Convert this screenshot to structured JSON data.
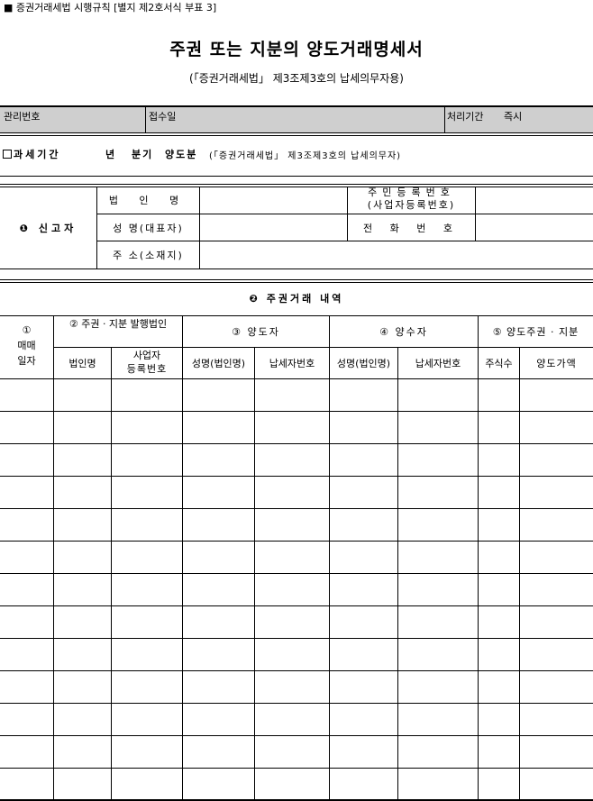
{
  "header": {
    "law_reference": "■ 증권거래세법 시행규칙 [별지 제2호서식 부표 3]",
    "title": "주권 또는 지분의 양도거래명세서",
    "subtitle": "(「증권거래세법」 제3조제3호의 납세의무자용)"
  },
  "admin": {
    "management_number": "관리번호",
    "receipt_date": "접수일",
    "processing_period": "처리기간",
    "processing_value": "즉시"
  },
  "period": {
    "label": "과세기간",
    "year": "년",
    "quarter": "분기",
    "transfer": "양도분",
    "note": "(「증권거래세법」 제3조제3호의 납세의무자)"
  },
  "reporter": {
    "section_label": "❶ 신고자",
    "corp_name": "법 인 명",
    "representative": "성 명(대표자)",
    "address": "주 소(소재지)",
    "resident_no_line1": "주민등록번호",
    "resident_no_line2": "(사업자등록번호)",
    "phone": "전 화 번 호"
  },
  "transactions": {
    "section_label": "❷ 주권거래 내역",
    "col1": "① 매매 일자",
    "col1_a": "①",
    "col1_b": "매매",
    "col1_c": "일자",
    "col2": "② 주권 · 지분 발행법인",
    "col2_sub1": "법인명",
    "col2_sub2_a": "사업자",
    "col2_sub2_b": "등록번호",
    "col3": "③ 양도자",
    "col3_sub1": "성명(법인명)",
    "col3_sub2": "납세자번호",
    "col4": "④ 양수자",
    "col4_sub1": "성명(법인명)",
    "col4_sub2": "납세자번호",
    "col5": "⑤ 양도주권 · 지분",
    "col5_sub1": "주식수",
    "col5_sub2": "양도가액"
  },
  "table_rows": [
    [
      "",
      "",
      "",
      "",
      "",
      "",
      "",
      "",
      ""
    ],
    [
      "",
      "",
      "",
      "",
      "",
      "",
      "",
      "",
      ""
    ],
    [
      "",
      "",
      "",
      "",
      "",
      "",
      "",
      "",
      ""
    ],
    [
      "",
      "",
      "",
      "",
      "",
      "",
      "",
      "",
      ""
    ],
    [
      "",
      "",
      "",
      "",
      "",
      "",
      "",
      "",
      ""
    ],
    [
      "",
      "",
      "",
      "",
      "",
      "",
      "",
      "",
      ""
    ],
    [
      "",
      "",
      "",
      "",
      "",
      "",
      "",
      "",
      ""
    ],
    [
      "",
      "",
      "",
      "",
      "",
      "",
      "",
      "",
      ""
    ],
    [
      "",
      "",
      "",
      "",
      "",
      "",
      "",
      "",
      ""
    ],
    [
      "",
      "",
      "",
      "",
      "",
      "",
      "",
      "",
      ""
    ],
    [
      "",
      "",
      "",
      "",
      "",
      "",
      "",
      "",
      ""
    ],
    [
      "",
      "",
      "",
      "",
      "",
      "",
      "",
      "",
      ""
    ],
    [
      "",
      "",
      "",
      "",
      "",
      "",
      "",
      "",
      ""
    ]
  ],
  "colors": {
    "admin_bg": "#cfcfcf",
    "line": "#000000"
  }
}
